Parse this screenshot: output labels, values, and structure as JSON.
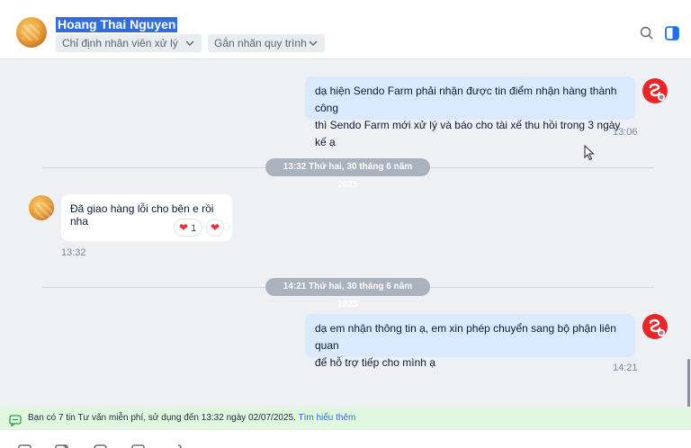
{
  "header": {
    "contact_name": "Hoang Thai Nguyen",
    "assign_staff_label": "Chỉ định nhân viên xử lý",
    "tag_process_label": "Gắn nhãn quy trình"
  },
  "messages": [
    {
      "direction": "out",
      "lines": [
        "dạ hiện Sendo Farm phải nhận được tin điểm nhận hàng thành công",
        "thì Sendo Farm mới xử lý và báo cho tài xế thu hồi trong 3 ngày kế ạ"
      ],
      "time": "13:06"
    },
    {
      "direction": "in",
      "text": "Đã giao hàng lỗi cho bên e rồi nha",
      "reaction_count": "1",
      "time": "13:32"
    },
    {
      "direction": "out",
      "lines": [
        "dạ em nhận thông tin ạ, em xin phép chuyển sang bộ phận liên quan",
        "để hỗ trợ tiếp cho mình ạ"
      ],
      "time": "14:21"
    }
  ],
  "dividers": [
    "13:32 Thứ hai, 30 tháng 6 năm 2025",
    "14:21 Thứ hai, 30 tháng 6 năm 2025"
  ],
  "banner": {
    "text": "Bạn có 7 tin Tư vấn miễn phí, sử dụng đến 13:32 ngày 02/07/2025.",
    "link": "Tìm hiểu thêm"
  },
  "colors": {
    "outgoing_bubble": "#dbe9ff",
    "incoming_bubble": "#ffffff",
    "brand_red": "#e8262a",
    "link_blue": "#2f6fd7",
    "banner_bg": "#e2f7df"
  },
  "icons": [
    "search-icon",
    "sidebar-toggle-icon",
    "heart-icon",
    "chat-bubble-icon"
  ]
}
